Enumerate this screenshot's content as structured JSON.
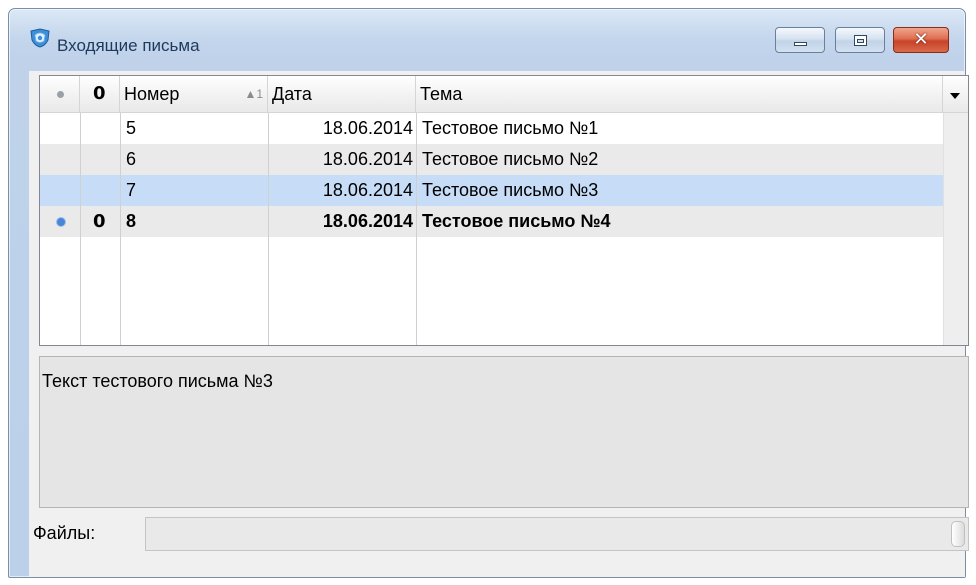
{
  "window": {
    "title": "Входящие письма",
    "icon": "mail-shield-icon",
    "controls": [
      "minimize",
      "maximize",
      "close"
    ],
    "close_symbol": "✕"
  },
  "grid": {
    "columns": {
      "read_icon": "dot-icon",
      "attach_icon": "paperclip-icon",
      "attach_symbol": "0",
      "number": "Номер",
      "number_sort": "▲1",
      "date": "Дата",
      "subject": "Тема"
    },
    "rows": [
      {
        "read": false,
        "attach": false,
        "number": "5",
        "date": "18.06.2014",
        "subject": "Тестовое письмо №1",
        "bold": false,
        "selected": false
      },
      {
        "read": false,
        "attach": false,
        "number": "6",
        "date": "18.06.2014",
        "subject": "Тестовое письмо №2",
        "bold": false,
        "selected": false
      },
      {
        "read": false,
        "attach": false,
        "number": "7",
        "date": "18.06.2014",
        "subject": "Тестовое письмо №3",
        "bold": false,
        "selected": true
      },
      {
        "read": true,
        "attach": true,
        "number": "8",
        "date": "18.06.2014",
        "subject": "Тестовое письмо №4",
        "bold": true,
        "selected": false
      }
    ]
  },
  "preview": {
    "text": "Текст тестового письма №3"
  },
  "files": {
    "label": "Файлы:",
    "value": ""
  },
  "colors": {
    "selection": "#c6dcf7",
    "unread_dot": "#4a86d8",
    "alt_row": "#eaeaea"
  }
}
